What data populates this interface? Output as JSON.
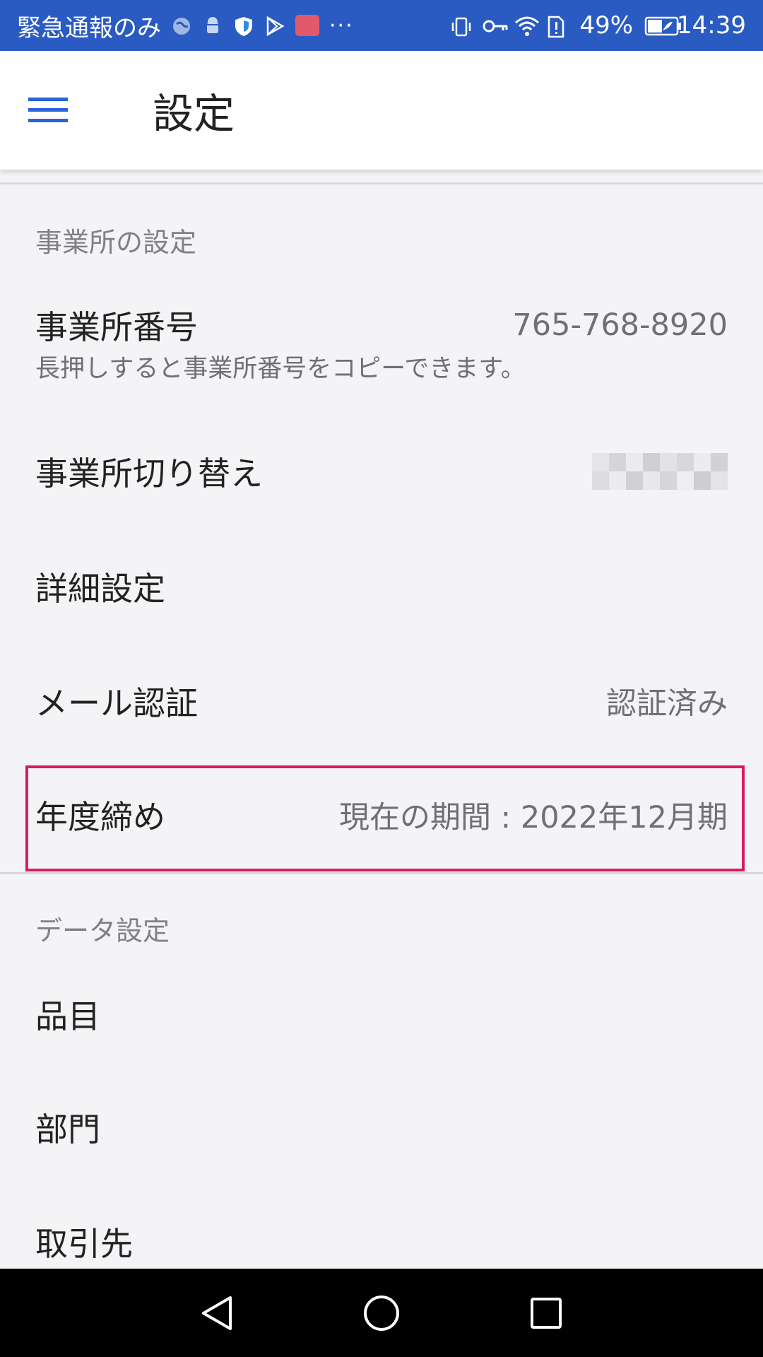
{
  "status_bar": {
    "carrier": "緊急通報のみ",
    "battery": "49%",
    "time": "14:39"
  },
  "app_bar": {
    "title": "設定"
  },
  "sections": [
    {
      "header": "事業所の設定",
      "items": [
        {
          "label": "事業所番号",
          "value": "765-768-8920",
          "sub": "長押しすると事業所番号をコピーできます。"
        },
        {
          "label": "事業所切り替え",
          "value": ""
        },
        {
          "label": "詳細設定",
          "value": ""
        },
        {
          "label": "メール認証",
          "value": "認証済み"
        },
        {
          "label": "年度締め",
          "value": "現在の期間 : 2022年12月期"
        }
      ]
    },
    {
      "header": "データ設定",
      "items": [
        {
          "label": "品目"
        },
        {
          "label": "部門"
        },
        {
          "label": "取引先"
        }
      ]
    }
  ],
  "colors": {
    "status_bar": "#2a5bc3",
    "accent": "#2a63d6",
    "highlight": "#d81b60"
  }
}
